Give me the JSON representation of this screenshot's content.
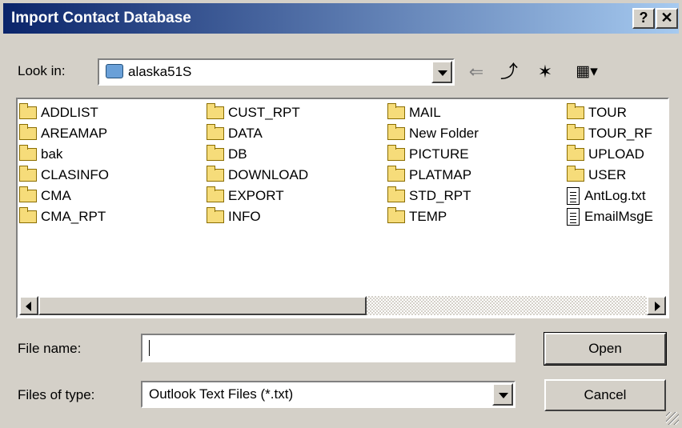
{
  "window": {
    "title": "Import Contact Database",
    "help_glyph": "?",
    "close_glyph": "✕"
  },
  "look_in": {
    "label": "Look in:",
    "value": "alaska51S"
  },
  "toolbar": {
    "back_glyph": "⇐",
    "up_glyph": "⤴",
    "new_folder_glyph": "✶",
    "view_glyph": "▦▾"
  },
  "file_list": {
    "items": [
      {
        "name": "ADDLIST",
        "type": "folder"
      },
      {
        "name": "AREAMAP",
        "type": "folder"
      },
      {
        "name": "bak",
        "type": "folder"
      },
      {
        "name": "CLASINFO",
        "type": "folder"
      },
      {
        "name": "CMA",
        "type": "folder"
      },
      {
        "name": "CMA_RPT",
        "type": "folder"
      },
      {
        "name": "CUST_RPT",
        "type": "folder"
      },
      {
        "name": "DATA",
        "type": "folder"
      },
      {
        "name": "DB",
        "type": "folder"
      },
      {
        "name": "DOWNLOAD",
        "type": "folder"
      },
      {
        "name": "EXPORT",
        "type": "folder"
      },
      {
        "name": "INFO",
        "type": "folder"
      },
      {
        "name": "MAIL",
        "type": "folder"
      },
      {
        "name": "New Folder",
        "type": "folder"
      },
      {
        "name": "PICTURE",
        "type": "folder"
      },
      {
        "name": "PLATMAP",
        "type": "folder"
      },
      {
        "name": "STD_RPT",
        "type": "folder"
      },
      {
        "name": "TEMP",
        "type": "folder"
      },
      {
        "name": "TOUR",
        "type": "folder"
      },
      {
        "name": "TOUR_RF",
        "type": "folder"
      },
      {
        "name": "UPLOAD",
        "type": "folder"
      },
      {
        "name": "USER",
        "type": "folder"
      },
      {
        "name": "AntLog.txt",
        "type": "file"
      },
      {
        "name": "EmailMsgE",
        "type": "file"
      }
    ]
  },
  "file_name": {
    "label": "File name:",
    "value": ""
  },
  "file_type": {
    "label": "Files of type:",
    "value": "Outlook Text Files (*.txt)"
  },
  "buttons": {
    "open": "Open",
    "cancel": "Cancel"
  },
  "colors": {
    "title_start": "#0a246a",
    "title_end": "#a6caf0",
    "face": "#d4d0c8",
    "folder": "#f6dc7a"
  }
}
